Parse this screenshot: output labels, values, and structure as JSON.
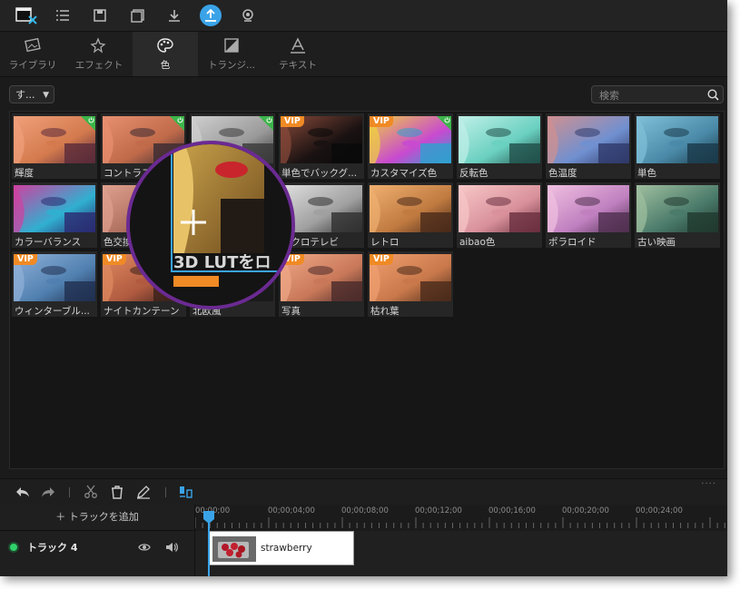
{
  "toolbar": {
    "buttons": [
      "logo",
      "list",
      "save",
      "save-as",
      "download",
      "export",
      "webcam"
    ],
    "active": "export",
    "accent_color": "#3aa3e8"
  },
  "tabs": [
    {
      "label": "ライブラリ",
      "icon": "library-icon"
    },
    {
      "label": "エフェクト",
      "icon": "sparkle-icon"
    },
    {
      "label": "色",
      "icon": "palette-icon",
      "active": true
    },
    {
      "label": "トランジ...",
      "icon": "transition-icon"
    },
    {
      "label": "テキスト",
      "icon": "text-icon"
    }
  ],
  "filter": {
    "dropdown_value": "す...",
    "search_placeholder": "検索"
  },
  "filters": [
    {
      "name": "輝度",
      "badge": "free"
    },
    {
      "name": "コントラスト",
      "badge": "free"
    },
    {
      "name": "",
      "badge": "free"
    },
    {
      "name": "単色でバックグ...",
      "badge": "vip"
    },
    {
      "name": "カスタマイズ色",
      "badge": "vip-free"
    },
    {
      "name": "反転色",
      "badge": ""
    },
    {
      "name": "色温度",
      "badge": ""
    },
    {
      "name": "単色",
      "badge": ""
    },
    {
      "name": "カラーバランス",
      "badge": ""
    },
    {
      "name": "色交換",
      "badge": ""
    },
    {
      "name": "",
      "badge": ""
    },
    {
      "name": "ノクロテレビ",
      "badge": ""
    },
    {
      "name": "レトロ",
      "badge": ""
    },
    {
      "name": "aibao色",
      "badge": ""
    },
    {
      "name": "ポラロイド",
      "badge": ""
    },
    {
      "name": "古い映画",
      "badge": ""
    },
    {
      "name": "ウィンターブル...",
      "badge": "vip"
    },
    {
      "name": "ナイトカンテーン",
      "badge": "vip"
    },
    {
      "name": "北欧風",
      "badge": ""
    },
    {
      "name": "写真",
      "badge": "vip"
    },
    {
      "name": "枯れ葉",
      "badge": "vip"
    }
  ],
  "vip_label": "VIP",
  "magnifier": {
    "text": "3D LUTをロ"
  },
  "timeline": {
    "add_track_label": "＋ トラックを追加",
    "track_name": "トラック 4",
    "ruler_labels": [
      "00;00;00",
      "00;00;04;00",
      "00;00;08;00",
      "00;00;12;00",
      "00;00;16;00",
      "00;00;20;00",
      "00;00;24;00"
    ],
    "clip_label": "strawberry",
    "dots": "...."
  }
}
